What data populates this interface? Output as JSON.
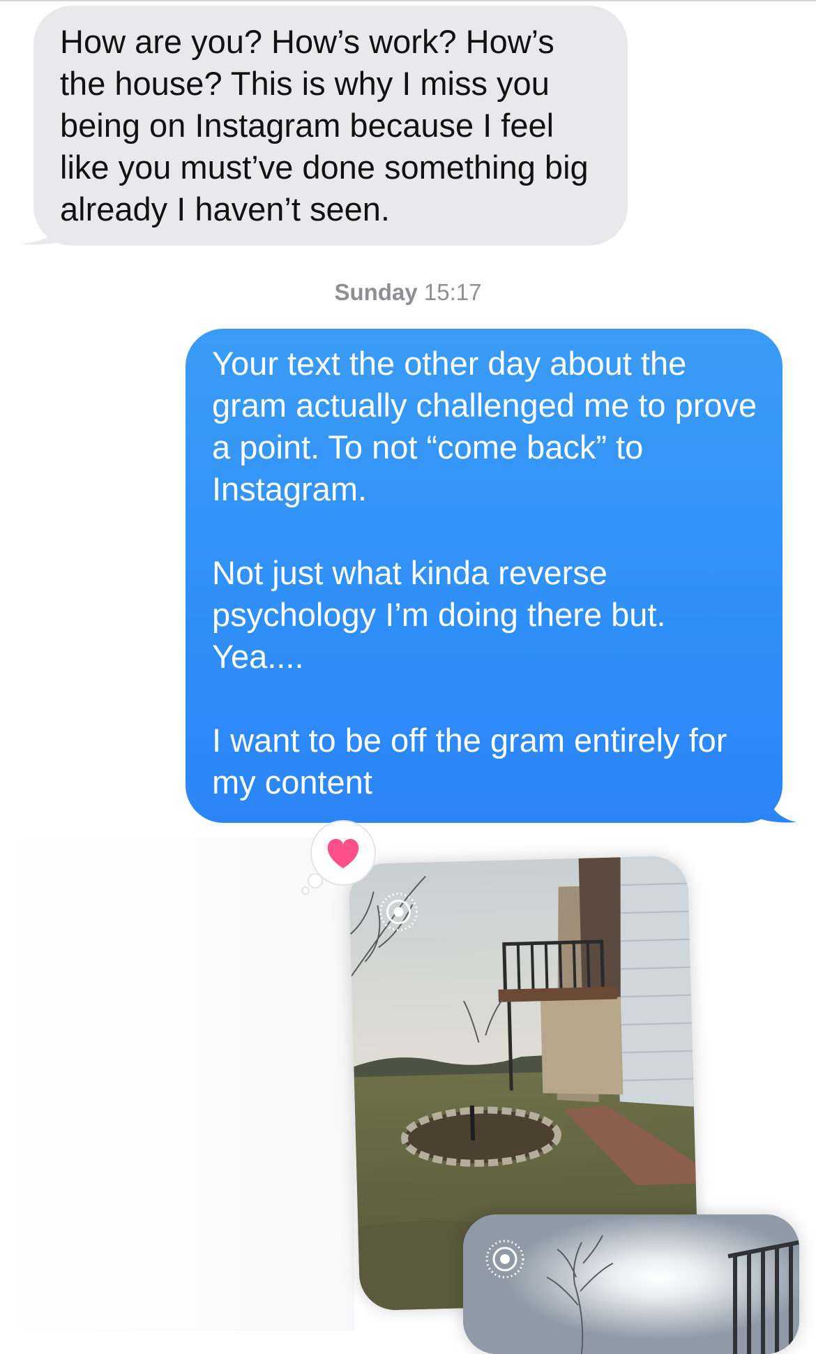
{
  "conversation": {
    "received": {
      "text": "How are you? How’s work? How’s the house? This is why I miss you being on Instagram because I feel like you must’ve done something big already I haven’t seen."
    },
    "timestamp": {
      "day": "Sunday",
      "time": "15:17"
    },
    "sent": {
      "paragraphs": [
        "Your text the other day about the gram actually challenged me to prove a point. To not “come back” to Instagram.",
        "Not just what kinda reverse psychology I’m doing there but. Yea....",
        "I want to be off the gram entirely for my content"
      ],
      "tapback": "heart-icon"
    },
    "attachments": [
      {
        "kind": "live-photo",
        "icon": "live-photo-icon"
      },
      {
        "kind": "live-photo",
        "icon": "live-photo-icon"
      }
    ]
  },
  "colors": {
    "received_bubble": "#e9e9eb",
    "sent_bubble": "#2f8ff8",
    "timestamp": "#8e8e93",
    "tapback_heart": "#ff4f8b"
  }
}
